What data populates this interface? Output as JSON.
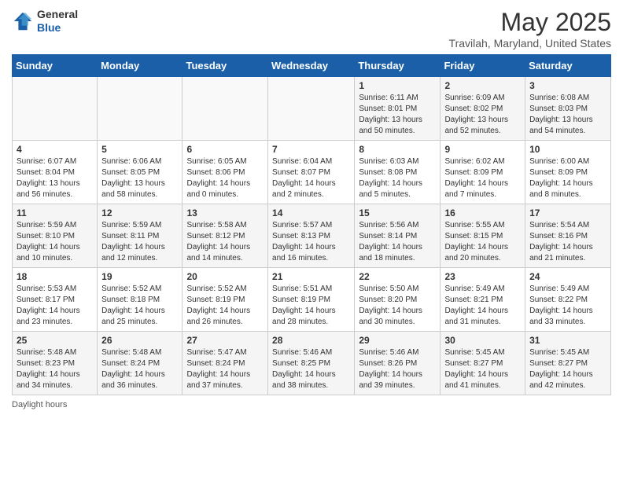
{
  "header": {
    "logo": {
      "general": "General",
      "blue": "Blue"
    },
    "title": "May 2025",
    "subtitle": "Travilah, Maryland, United States"
  },
  "days_of_week": [
    "Sunday",
    "Monday",
    "Tuesday",
    "Wednesday",
    "Thursday",
    "Friday",
    "Saturday"
  ],
  "weeks": [
    [
      {
        "day": "",
        "info": ""
      },
      {
        "day": "",
        "info": ""
      },
      {
        "day": "",
        "info": ""
      },
      {
        "day": "",
        "info": ""
      },
      {
        "day": "1",
        "info": "Sunrise: 6:11 AM\nSunset: 8:01 PM\nDaylight: 13 hours\nand 50 minutes."
      },
      {
        "day": "2",
        "info": "Sunrise: 6:09 AM\nSunset: 8:02 PM\nDaylight: 13 hours\nand 52 minutes."
      },
      {
        "day": "3",
        "info": "Sunrise: 6:08 AM\nSunset: 8:03 PM\nDaylight: 13 hours\nand 54 minutes."
      }
    ],
    [
      {
        "day": "4",
        "info": "Sunrise: 6:07 AM\nSunset: 8:04 PM\nDaylight: 13 hours\nand 56 minutes."
      },
      {
        "day": "5",
        "info": "Sunrise: 6:06 AM\nSunset: 8:05 PM\nDaylight: 13 hours\nand 58 minutes."
      },
      {
        "day": "6",
        "info": "Sunrise: 6:05 AM\nSunset: 8:06 PM\nDaylight: 14 hours\nand 0 minutes."
      },
      {
        "day": "7",
        "info": "Sunrise: 6:04 AM\nSunset: 8:07 PM\nDaylight: 14 hours\nand 2 minutes."
      },
      {
        "day": "8",
        "info": "Sunrise: 6:03 AM\nSunset: 8:08 PM\nDaylight: 14 hours\nand 5 minutes."
      },
      {
        "day": "9",
        "info": "Sunrise: 6:02 AM\nSunset: 8:09 PM\nDaylight: 14 hours\nand 7 minutes."
      },
      {
        "day": "10",
        "info": "Sunrise: 6:00 AM\nSunset: 8:09 PM\nDaylight: 14 hours\nand 8 minutes."
      }
    ],
    [
      {
        "day": "11",
        "info": "Sunrise: 5:59 AM\nSunset: 8:10 PM\nDaylight: 14 hours\nand 10 minutes."
      },
      {
        "day": "12",
        "info": "Sunrise: 5:59 AM\nSunset: 8:11 PM\nDaylight: 14 hours\nand 12 minutes."
      },
      {
        "day": "13",
        "info": "Sunrise: 5:58 AM\nSunset: 8:12 PM\nDaylight: 14 hours\nand 14 minutes."
      },
      {
        "day": "14",
        "info": "Sunrise: 5:57 AM\nSunset: 8:13 PM\nDaylight: 14 hours\nand 16 minutes."
      },
      {
        "day": "15",
        "info": "Sunrise: 5:56 AM\nSunset: 8:14 PM\nDaylight: 14 hours\nand 18 minutes."
      },
      {
        "day": "16",
        "info": "Sunrise: 5:55 AM\nSunset: 8:15 PM\nDaylight: 14 hours\nand 20 minutes."
      },
      {
        "day": "17",
        "info": "Sunrise: 5:54 AM\nSunset: 8:16 PM\nDaylight: 14 hours\nand 21 minutes."
      }
    ],
    [
      {
        "day": "18",
        "info": "Sunrise: 5:53 AM\nSunset: 8:17 PM\nDaylight: 14 hours\nand 23 minutes."
      },
      {
        "day": "19",
        "info": "Sunrise: 5:52 AM\nSunset: 8:18 PM\nDaylight: 14 hours\nand 25 minutes."
      },
      {
        "day": "20",
        "info": "Sunrise: 5:52 AM\nSunset: 8:19 PM\nDaylight: 14 hours\nand 26 minutes."
      },
      {
        "day": "21",
        "info": "Sunrise: 5:51 AM\nSunset: 8:19 PM\nDaylight: 14 hours\nand 28 minutes."
      },
      {
        "day": "22",
        "info": "Sunrise: 5:50 AM\nSunset: 8:20 PM\nDaylight: 14 hours\nand 30 minutes."
      },
      {
        "day": "23",
        "info": "Sunrise: 5:49 AM\nSunset: 8:21 PM\nDaylight: 14 hours\nand 31 minutes."
      },
      {
        "day": "24",
        "info": "Sunrise: 5:49 AM\nSunset: 8:22 PM\nDaylight: 14 hours\nand 33 minutes."
      }
    ],
    [
      {
        "day": "25",
        "info": "Sunrise: 5:48 AM\nSunset: 8:23 PM\nDaylight: 14 hours\nand 34 minutes."
      },
      {
        "day": "26",
        "info": "Sunrise: 5:48 AM\nSunset: 8:24 PM\nDaylight: 14 hours\nand 36 minutes."
      },
      {
        "day": "27",
        "info": "Sunrise: 5:47 AM\nSunset: 8:24 PM\nDaylight: 14 hours\nand 37 minutes."
      },
      {
        "day": "28",
        "info": "Sunrise: 5:46 AM\nSunset: 8:25 PM\nDaylight: 14 hours\nand 38 minutes."
      },
      {
        "day": "29",
        "info": "Sunrise: 5:46 AM\nSunset: 8:26 PM\nDaylight: 14 hours\nand 39 minutes."
      },
      {
        "day": "30",
        "info": "Sunrise: 5:45 AM\nSunset: 8:27 PM\nDaylight: 14 hours\nand 41 minutes."
      },
      {
        "day": "31",
        "info": "Sunrise: 5:45 AM\nSunset: 8:27 PM\nDaylight: 14 hours\nand 42 minutes."
      }
    ]
  ],
  "footer": "Daylight hours"
}
